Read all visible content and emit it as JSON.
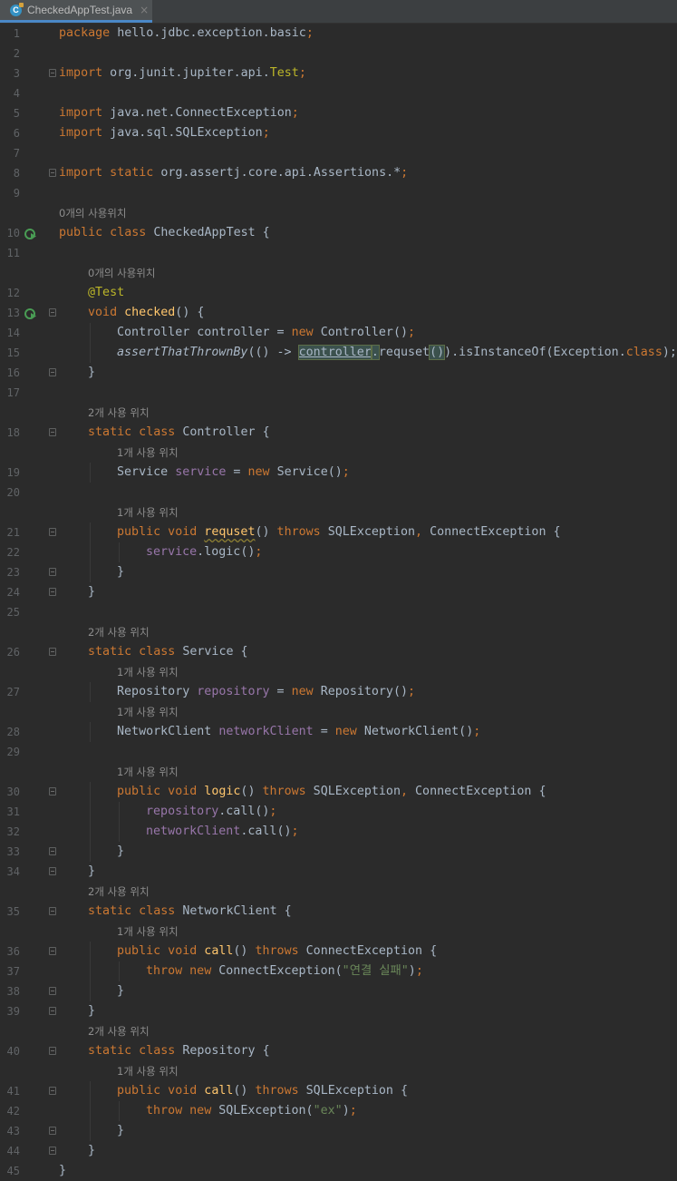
{
  "tab": {
    "filename": "CheckedAppTest.java",
    "close": "×",
    "icon": "class-file-icon"
  },
  "colors": {
    "background": "#2b2b2b",
    "keyword": "#cc7832",
    "method": "#ffc66d",
    "field": "#9876aa",
    "string": "#6a8759",
    "annotation": "#bbb529",
    "text": "#a9b7c6"
  },
  "lines": [
    {
      "n": "1",
      "indent": 0,
      "tokens": [
        [
          "package",
          "kw"
        ],
        [
          " hello.jdbc.exception.basic",
          ""
        ],
        [
          ";",
          "kw"
        ]
      ]
    },
    {
      "n": "2",
      "indent": 0,
      "tokens": []
    },
    {
      "n": "3",
      "indent": 0,
      "fold": true,
      "tokens": [
        [
          "import",
          "kw"
        ],
        [
          " org.junit.jupiter.api.",
          ""
        ],
        [
          "Test",
          "ann"
        ],
        [
          ";",
          "kw"
        ]
      ]
    },
    {
      "n": "4",
      "indent": 0,
      "tokens": []
    },
    {
      "n": "5",
      "indent": 0,
      "tokens": [
        [
          "import",
          "kw"
        ],
        [
          " java.net.ConnectException",
          ""
        ],
        [
          ";",
          "kw"
        ]
      ]
    },
    {
      "n": "6",
      "indent": 0,
      "tokens": [
        [
          "import",
          "kw"
        ],
        [
          " java.sql.SQLException",
          ""
        ],
        [
          ";",
          "kw"
        ]
      ]
    },
    {
      "n": "7",
      "indent": 0,
      "tokens": []
    },
    {
      "n": "8",
      "indent": 0,
      "fold": true,
      "tokens": [
        [
          "import static",
          "kw"
        ],
        [
          " org.assertj.core.api.Assertions.",
          ""
        ],
        [
          "*",
          ""
        ],
        [
          ";",
          "kw"
        ]
      ]
    },
    {
      "n": "9",
      "indent": 0,
      "tokens": []
    },
    {
      "hint": "0개의 사용위치",
      "indent": 0
    },
    {
      "n": "10",
      "indent": 0,
      "run": true,
      "tokens": [
        [
          "public class",
          "kw"
        ],
        [
          " CheckedAppTest {",
          ""
        ]
      ]
    },
    {
      "n": "11",
      "indent": 0,
      "tokens": []
    },
    {
      "hint": "0개의 사용위치",
      "indent": 1
    },
    {
      "n": "12",
      "indent": 1,
      "tokens": [
        [
          "@Test",
          "ann"
        ]
      ]
    },
    {
      "n": "13",
      "indent": 1,
      "run": true,
      "fold": true,
      "tokens": [
        [
          "void ",
          "kw"
        ],
        [
          "checked",
          "fn"
        ],
        [
          "() {",
          ""
        ]
      ]
    },
    {
      "n": "14",
      "indent": 2,
      "tokens": [
        [
          "Controller controller = ",
          ""
        ],
        [
          "new ",
          "kw"
        ],
        [
          "Controller()",
          ""
        ],
        [
          ";",
          "kw"
        ]
      ]
    },
    {
      "n": "15",
      "indent": 2,
      "tokens": [
        [
          "assertThatThrownBy",
          "ital"
        ],
        [
          "(() -> ",
          ""
        ],
        [
          "controller",
          "hl ref"
        ],
        [
          ".",
          "hl"
        ],
        [
          "requset",
          ""
        ],
        [
          "()",
          "hl"
        ],
        [
          ").isInstanceOf(Exception.",
          ""
        ],
        [
          "class",
          "kw"
        ],
        [
          ");",
          ""
        ]
      ]
    },
    {
      "n": "16",
      "indent": 1,
      "fold": true,
      "tokens": [
        [
          "}",
          ""
        ]
      ]
    },
    {
      "n": "17",
      "indent": 0,
      "tokens": []
    },
    {
      "hint": "2개 사용 위치",
      "indent": 1
    },
    {
      "n": "18",
      "indent": 1,
      "fold": true,
      "tokens": [
        [
          "static class",
          "kw"
        ],
        [
          " Controller {",
          ""
        ]
      ]
    },
    {
      "hint": "1개 사용 위치",
      "indent": 2
    },
    {
      "n": "19",
      "indent": 2,
      "tokens": [
        [
          "Service ",
          ""
        ],
        [
          "service",
          "fld"
        ],
        [
          " = ",
          ""
        ],
        [
          "new ",
          "kw"
        ],
        [
          "Service()",
          ""
        ],
        [
          ";",
          "kw"
        ]
      ]
    },
    {
      "n": "20",
      "indent": 0,
      "tokens": []
    },
    {
      "hint": "1개 사용 위치",
      "indent": 2
    },
    {
      "n": "21",
      "indent": 2,
      "fold": true,
      "tokens": [
        [
          "public void ",
          "kw"
        ],
        [
          "requset",
          "fn warn"
        ],
        [
          "() ",
          ""
        ],
        [
          "throws ",
          "kw"
        ],
        [
          "SQLException",
          ""
        ],
        [
          ", ",
          "kw"
        ],
        [
          "ConnectException {",
          ""
        ]
      ]
    },
    {
      "n": "22",
      "indent": 3,
      "tokens": [
        [
          "service",
          "fld"
        ],
        [
          ".logic()",
          ""
        ],
        [
          ";",
          "kw"
        ]
      ]
    },
    {
      "n": "23",
      "indent": 2,
      "fold": true,
      "tokens": [
        [
          "}",
          ""
        ]
      ]
    },
    {
      "n": "24",
      "indent": 1,
      "fold": true,
      "tokens": [
        [
          "}",
          ""
        ]
      ]
    },
    {
      "n": "25",
      "indent": 0,
      "tokens": []
    },
    {
      "hint": "2개 사용 위치",
      "indent": 1
    },
    {
      "n": "26",
      "indent": 1,
      "fold": true,
      "tokens": [
        [
          "static class",
          "kw"
        ],
        [
          " Service {",
          ""
        ]
      ]
    },
    {
      "hint": "1개 사용 위치",
      "indent": 2
    },
    {
      "n": "27",
      "indent": 2,
      "tokens": [
        [
          "Repository ",
          ""
        ],
        [
          "repository",
          "fld"
        ],
        [
          " = ",
          ""
        ],
        [
          "new ",
          "kw"
        ],
        [
          "Repository()",
          ""
        ],
        [
          ";",
          "kw"
        ]
      ]
    },
    {
      "hint": "1개 사용 위치",
      "indent": 2
    },
    {
      "n": "28",
      "indent": 2,
      "tokens": [
        [
          "NetworkClient ",
          ""
        ],
        [
          "networkClient",
          "fld"
        ],
        [
          " = ",
          ""
        ],
        [
          "new ",
          "kw"
        ],
        [
          "NetworkClient()",
          ""
        ],
        [
          ";",
          "kw"
        ]
      ]
    },
    {
      "n": "29",
      "indent": 0,
      "tokens": []
    },
    {
      "hint": "1개 사용 위치",
      "indent": 2
    },
    {
      "n": "30",
      "indent": 2,
      "fold": true,
      "tokens": [
        [
          "public void ",
          "kw"
        ],
        [
          "logic",
          "fn"
        ],
        [
          "() ",
          ""
        ],
        [
          "throws ",
          "kw"
        ],
        [
          "SQLException",
          ""
        ],
        [
          ", ",
          "kw"
        ],
        [
          "ConnectException {",
          ""
        ]
      ]
    },
    {
      "n": "31",
      "indent": 3,
      "tokens": [
        [
          "repository",
          "fld"
        ],
        [
          ".call()",
          ""
        ],
        [
          ";",
          "kw"
        ]
      ]
    },
    {
      "n": "32",
      "indent": 3,
      "tokens": [
        [
          "networkClient",
          "fld"
        ],
        [
          ".call()",
          ""
        ],
        [
          ";",
          "kw"
        ]
      ]
    },
    {
      "n": "33",
      "indent": 2,
      "fold": true,
      "tokens": [
        [
          "}",
          ""
        ]
      ]
    },
    {
      "n": "34",
      "indent": 1,
      "fold": true,
      "tokens": [
        [
          "}",
          ""
        ]
      ]
    },
    {
      "hint": "2개 사용 위치",
      "indent": 1
    },
    {
      "n": "35",
      "indent": 1,
      "fold": true,
      "tokens": [
        [
          "static class",
          "kw"
        ],
        [
          " NetworkClient {",
          ""
        ]
      ]
    },
    {
      "hint": "1개 사용 위치",
      "indent": 2
    },
    {
      "n": "36",
      "indent": 2,
      "fold": true,
      "tokens": [
        [
          "public void ",
          "kw"
        ],
        [
          "call",
          "fn"
        ],
        [
          "() ",
          ""
        ],
        [
          "throws ",
          "kw"
        ],
        [
          "ConnectException {",
          ""
        ]
      ]
    },
    {
      "n": "37",
      "indent": 3,
      "tokens": [
        [
          "throw new ",
          "kw"
        ],
        [
          "ConnectException(",
          ""
        ],
        [
          "\"연결 실패\"",
          "str"
        ],
        [
          ")",
          ""
        ],
        [
          ";",
          "kw"
        ]
      ]
    },
    {
      "n": "38",
      "indent": 2,
      "fold": true,
      "tokens": [
        [
          "}",
          ""
        ]
      ]
    },
    {
      "n": "39",
      "indent": 1,
      "fold": true,
      "tokens": [
        [
          "}",
          ""
        ]
      ]
    },
    {
      "hint": "2개 사용 위치",
      "indent": 1
    },
    {
      "n": "40",
      "indent": 1,
      "fold": true,
      "tokens": [
        [
          "static class",
          "kw"
        ],
        [
          " Repository {",
          ""
        ]
      ]
    },
    {
      "hint": "1개 사용 위치",
      "indent": 2
    },
    {
      "n": "41",
      "indent": 2,
      "fold": true,
      "tokens": [
        [
          "public void ",
          "kw"
        ],
        [
          "call",
          "fn"
        ],
        [
          "() ",
          ""
        ],
        [
          "throws ",
          "kw"
        ],
        [
          "SQLException {",
          ""
        ]
      ]
    },
    {
      "n": "42",
      "indent": 3,
      "tokens": [
        [
          "throw new ",
          "kw"
        ],
        [
          "SQLException(",
          ""
        ],
        [
          "\"ex\"",
          "str"
        ],
        [
          ")",
          ""
        ],
        [
          ";",
          "kw"
        ]
      ]
    },
    {
      "n": "43",
      "indent": 2,
      "fold": true,
      "tokens": [
        [
          "}",
          ""
        ]
      ]
    },
    {
      "n": "44",
      "indent": 1,
      "fold": true,
      "tokens": [
        [
          "}",
          ""
        ]
      ]
    },
    {
      "n": "45",
      "indent": 0,
      "tokens": [
        [
          "}",
          ""
        ]
      ]
    }
  ]
}
